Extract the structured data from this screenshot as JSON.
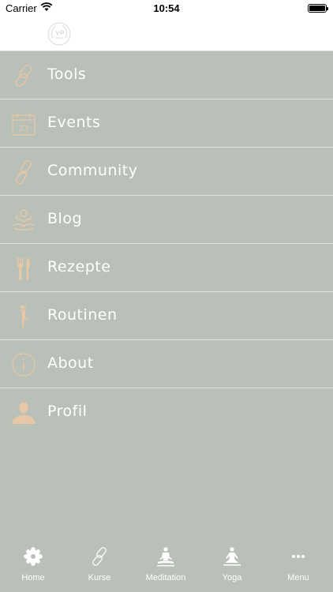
{
  "status_bar": {
    "carrier": "Carrier",
    "time": "10:54"
  },
  "colors": {
    "background": "#b9c0b7",
    "icon_accent": "#e8c7a6",
    "label_text": "#ffffff"
  },
  "menu": {
    "items": [
      {
        "label": "Tools",
        "icon": "link-icon"
      },
      {
        "label": "Events",
        "icon": "calendar-icon"
      },
      {
        "label": "Community",
        "icon": "chain-link-icon"
      },
      {
        "label": "Blog",
        "icon": "meditation-icon"
      },
      {
        "label": "Rezepte",
        "icon": "fork-knife-icon"
      },
      {
        "label": "Routinen",
        "icon": "yoga-pose-icon"
      },
      {
        "label": "About",
        "icon": "info-icon"
      },
      {
        "label": "Profil",
        "icon": "user-icon"
      }
    ]
  },
  "calendar_day": "23",
  "tabs": [
    {
      "label": "Home",
      "icon": "flower-icon"
    },
    {
      "label": "Kurse",
      "icon": "link-icon"
    },
    {
      "label": "Meditation",
      "icon": "meditation-icon"
    },
    {
      "label": "Yoga",
      "icon": "yoga-icon"
    },
    {
      "label": "Menu",
      "icon": "more-icon"
    }
  ]
}
